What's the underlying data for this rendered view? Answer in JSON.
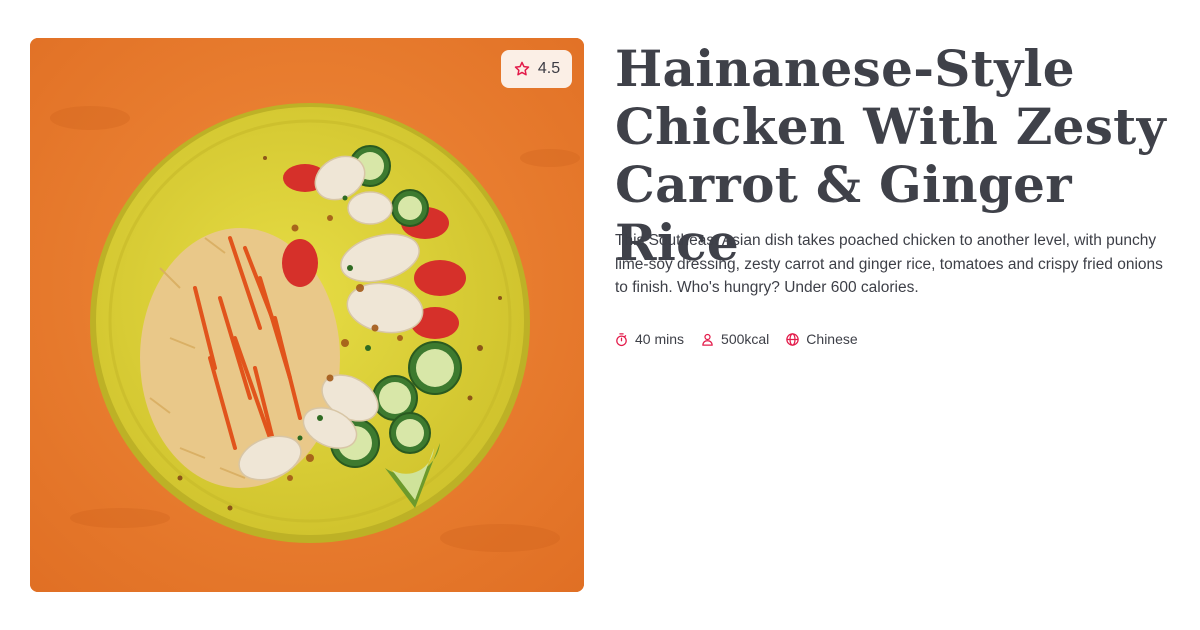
{
  "recipe": {
    "title": "Hainanese-Style Chicken With Zesty Carrot & Ginger Rice",
    "description": "This Southeast Asian dish takes poached chicken to another level, with punchy lime-soy dressing, zesty carrot and ginger rice, tomatoes and crispy fried onions to finish. Who's hungry? Under 600 calories.",
    "rating": "4.5",
    "meta": {
      "time": "40 mins",
      "calories": "500kcal",
      "cuisine": "Chinese"
    }
  },
  "icons": {
    "rating": "star-icon",
    "time": "stopwatch-icon",
    "calories": "person-icon",
    "cuisine": "globe-icon"
  },
  "colors": {
    "accent": "#e31b4a",
    "title": "#3f4149",
    "text": "#3d3f47",
    "image_background": "#e8782e",
    "plate": "#dcd236"
  }
}
